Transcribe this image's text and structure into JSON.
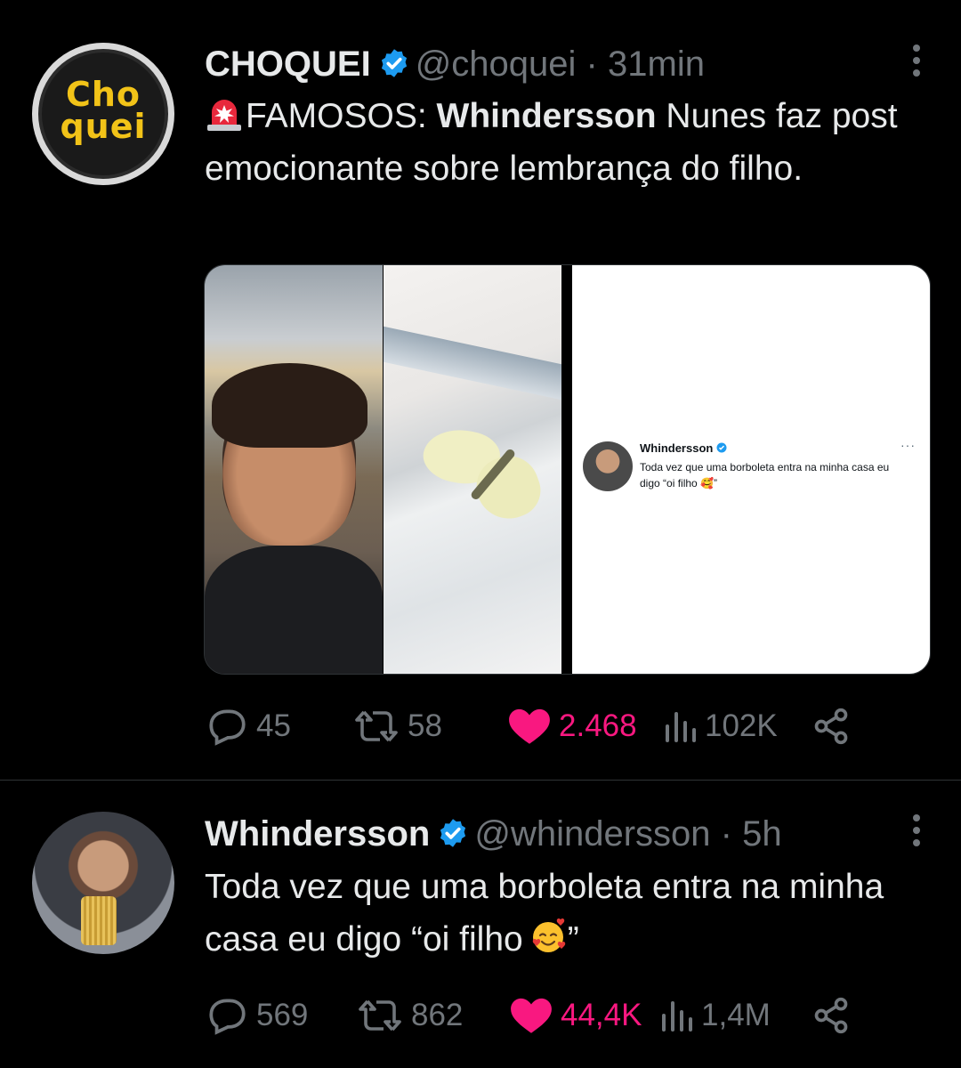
{
  "tweets": [
    {
      "author": {
        "name": "CHOQUEI",
        "handle": "@choquei",
        "time": "31min",
        "avatar_logo_line1": "Cho",
        "avatar_logo_line2": "quei"
      },
      "text": {
        "prefix": "FAMOSOS: ",
        "bold": "Whindersson",
        "rest": " Nunes faz post emocionante sobre lembrança do filho."
      },
      "embed": {
        "name": "Whindersson",
        "text": "Toda vez que uma borboleta entra na minha casa eu digo “oi filho 🥰”",
        "dots": "···"
      },
      "stats": {
        "replies": "45",
        "retweets": "58",
        "likes": "2.468",
        "views": "102K"
      }
    },
    {
      "author": {
        "name": "Whindersson",
        "handle": "@whindersson",
        "time": "5h"
      },
      "text": {
        "main": "Toda vez que uma borboleta entra na minha casa eu digo “oi filho",
        "close_quote": "”"
      },
      "stats": {
        "replies": "569",
        "retweets": "862",
        "likes": "44,4K",
        "views": "1,4M"
      }
    }
  ],
  "colors": {
    "background": "#000000",
    "text": "#e7e9ea",
    "secondary": "#71767b",
    "like": "#f91880",
    "verified": "#1d9bf0",
    "divider": "#2f3336"
  },
  "icons": [
    "verified-badge-icon",
    "more-icon",
    "siren-emoji-icon",
    "reply-icon",
    "retweet-icon",
    "heart-icon",
    "views-icon",
    "share-icon",
    "smiling-hearts-emoji-icon"
  ]
}
